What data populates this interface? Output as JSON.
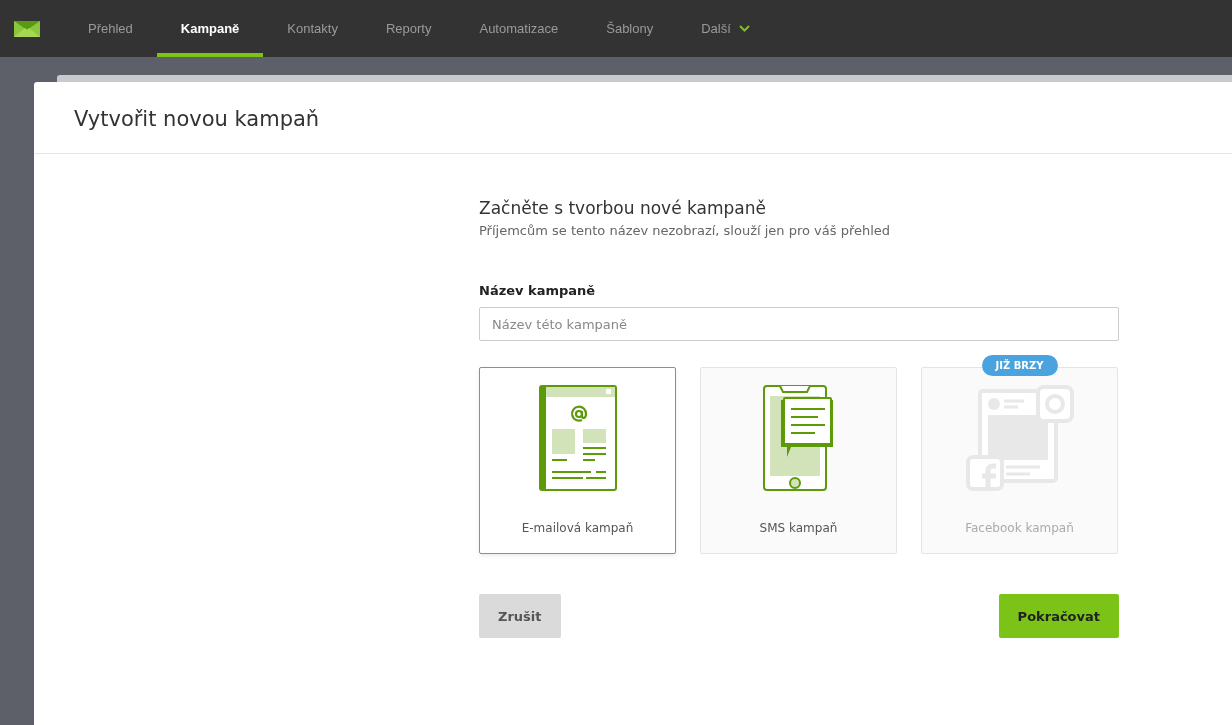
{
  "nav": {
    "items": [
      {
        "label": "Přehled",
        "selected": false,
        "dropdown": false
      },
      {
        "label": "Kampaně",
        "selected": true,
        "dropdown": false
      },
      {
        "label": "Kontakty",
        "selected": false,
        "dropdown": false
      },
      {
        "label": "Reporty",
        "selected": false,
        "dropdown": false
      },
      {
        "label": "Automatizace",
        "selected": false,
        "dropdown": false
      },
      {
        "label": "Šablony",
        "selected": false,
        "dropdown": false
      },
      {
        "label": "Další",
        "selected": false,
        "dropdown": true
      }
    ]
  },
  "dialog": {
    "title": "Vytvořit novou kampaň",
    "heading": "Začněte s tvorbou nové kampaně",
    "subheading": "Příjemcům se tento název nezobrazí, slouží jen pro váš přehled",
    "field": {
      "label": "Název kampaně",
      "placeholder": "Název této kampaně"
    },
    "types": [
      {
        "kind": "email",
        "label": "E-mailová kampaň",
        "selected": true,
        "disabled": false
      },
      {
        "kind": "sms",
        "label": "SMS kampaň",
        "selected": false,
        "disabled": false
      },
      {
        "kind": "facebook",
        "label": "Facebook kampaň",
        "selected": false,
        "disabled": true,
        "badge": "JIŽ BRZY"
      }
    ],
    "cancel": "Zrušit",
    "continue": "Pokračovat"
  }
}
